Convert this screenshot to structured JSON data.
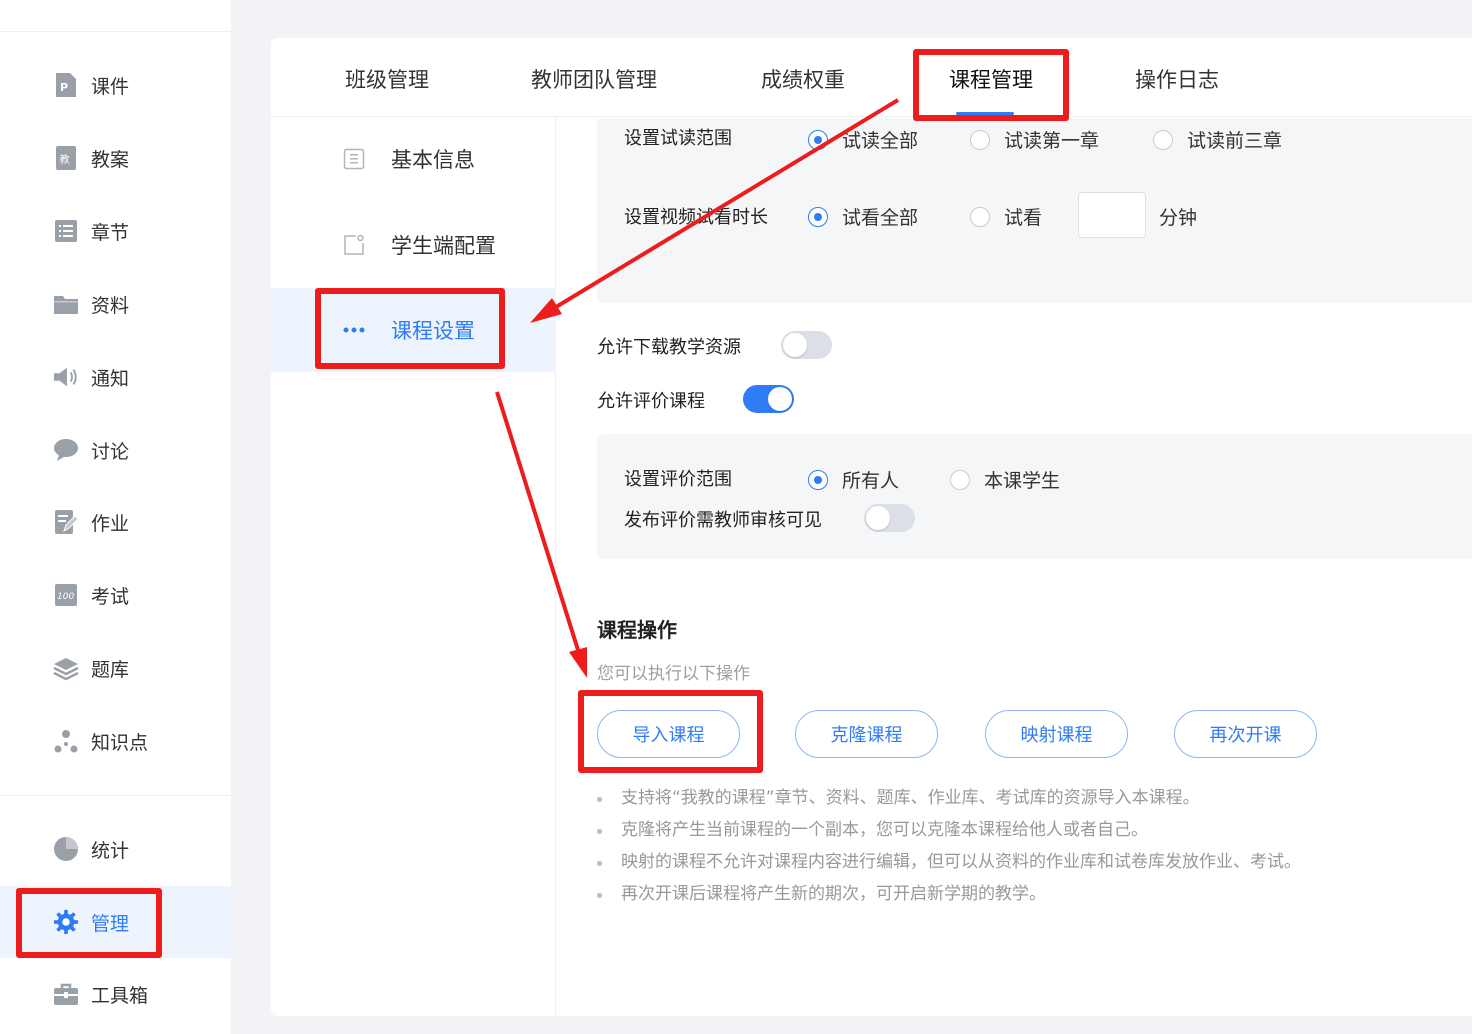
{
  "sidebar": {
    "items": [
      {
        "label": "课件",
        "icon": "courseware-icon"
      },
      {
        "label": "教案",
        "icon": "lesson-plan-icon"
      },
      {
        "label": "章节",
        "icon": "chapter-list-icon"
      },
      {
        "label": "资料",
        "icon": "folder-icon"
      },
      {
        "label": "通知",
        "icon": "speaker-icon"
      },
      {
        "label": "讨论",
        "icon": "chat-bubble-icon"
      },
      {
        "label": "作业",
        "icon": "homework-edit-icon"
      },
      {
        "label": "考试",
        "icon": "exam-icon"
      },
      {
        "label": "题库",
        "icon": "layers-icon"
      },
      {
        "label": "知识点",
        "icon": "knowledge-graph-icon"
      }
    ],
    "bottom_items": [
      {
        "label": "统计",
        "icon": "pie-chart-icon"
      },
      {
        "label": "管理",
        "icon": "gear-icon",
        "active": true
      },
      {
        "label": "工具箱",
        "icon": "toolbox-icon"
      }
    ]
  },
  "tabs": [
    {
      "label": "班级管理"
    },
    {
      "label": "教师团队管理"
    },
    {
      "label": "成绩权重"
    },
    {
      "label": "课程管理",
      "active": true
    },
    {
      "label": "操作日志"
    }
  ],
  "subnav": [
    {
      "label": "基本信息",
      "icon": "document-icon"
    },
    {
      "label": "学生端配置",
      "icon": "student-config-icon"
    },
    {
      "label": "课程设置",
      "icon": "more-dots-icon",
      "active": true
    }
  ],
  "preview": {
    "read_range_label": "设置试读范围",
    "read_options": [
      "试读全部",
      "试读第一章",
      "试读前三章"
    ],
    "read_selected": "试读全部",
    "video_label": "设置视频试看时长",
    "video_options": [
      "试看全部",
      "试看"
    ],
    "video_selected": "试看全部",
    "minutes_value": "",
    "minutes_unit": "分钟"
  },
  "downloads": {
    "label": "允许下载教学资源",
    "enabled": false
  },
  "evaluation": {
    "label": "允许评价课程",
    "enabled": true,
    "range_label": "设置评价范围",
    "range_options": [
      "所有人",
      "本课学生"
    ],
    "range_selected": "所有人",
    "review_label": "发布评价需教师审核可见",
    "review_enabled": false
  },
  "operations": {
    "title": "课程操作",
    "subtitle": "您可以执行以下操作",
    "buttons": [
      "导入课程",
      "克隆课程",
      "映射课程",
      "再次开课"
    ],
    "tips": [
      "支持将“我教的课程”章节、资料、题库、作业库、考试库的资源导入本课程。",
      "克隆将产生当前课程的一个副本，您可以克隆本课程给他人或者自己。",
      "映射的课程不允许对课程内容进行编辑，但可以从资料的作业库和试卷库发放作业、考试。",
      "再次开课后课程将产生新的期次，可开启新学期的教学。"
    ]
  },
  "colors": {
    "accent": "#2f7cf6",
    "annotation_red": "#ee1c1c",
    "background": "#f2f3f6"
  }
}
